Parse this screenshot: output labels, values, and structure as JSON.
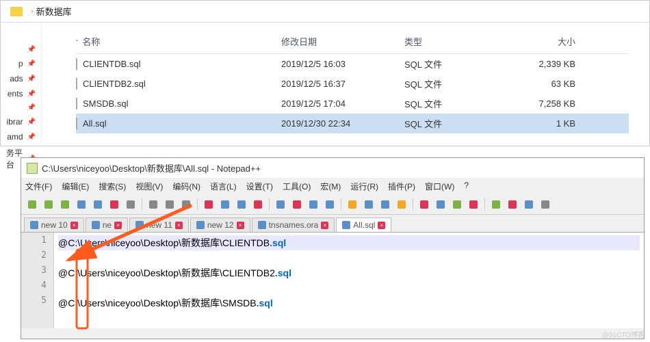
{
  "explorer": {
    "crumb": "新数据库",
    "headers": {
      "name": "名称",
      "date": "修改日期",
      "type": "类型",
      "size": "大小"
    },
    "rows": [
      {
        "name": "CLIENTDB.sql",
        "date": "2019/12/5 16:03",
        "type": "SQL 文件",
        "size": "2,339 KB",
        "sel": false
      },
      {
        "name": "CLIENTDB2.sql",
        "date": "2019/12/5 16:37",
        "type": "SQL 文件",
        "size": "63 KB",
        "sel": false
      },
      {
        "name": "SMSDB.sql",
        "date": "2019/12/5 17:04",
        "type": "SQL 文件",
        "size": "7,258 KB",
        "sel": false
      },
      {
        "name": "All.sql",
        "date": "2019/12/30 22:34",
        "type": "SQL 文件",
        "size": "1 KB",
        "sel": true
      }
    ],
    "sidebar": [
      "",
      "p",
      "ads",
      "ents",
      "",
      "ibrar",
      "amd",
      "务平台",
      ""
    ]
  },
  "notepad": {
    "title": "C:\\Users\\niceyoo\\Desktop\\新数据库\\All.sql - Notepad++",
    "menu": [
      "文件(F)",
      "编辑(E)",
      "搜索(S)",
      "视图(V)",
      "编码(N)",
      "语言(L)",
      "设置(T)",
      "工具(O)",
      "宏(M)",
      "运行(R)",
      "插件(P)",
      "窗口(W)",
      "?"
    ],
    "tabs": [
      {
        "label": "new 10",
        "active": false
      },
      {
        "label": "ne",
        "active": false
      },
      {
        "label": "new 11",
        "active": false
      },
      {
        "label": "new 12",
        "active": false
      },
      {
        "label": "tnsnames.ora",
        "active": false
      },
      {
        "label": "All.sql",
        "active": true
      }
    ],
    "lines": [
      {
        "n": "1",
        "pre": "@C:\\Users\\niceyoo\\Desktop\\新数据库\\CLIENTDB",
        "suf": ".sql",
        "hl": true
      },
      {
        "n": "2",
        "pre": "",
        "suf": "",
        "hl": false
      },
      {
        "n": "3",
        "pre": "@C:\\Users\\niceyoo\\Desktop\\新数据库\\CLIENTDB2",
        "suf": ".sql",
        "hl": false
      },
      {
        "n": "4",
        "pre": "",
        "suf": "",
        "hl": false
      },
      {
        "n": "5",
        "pre": "@C:\\Users\\niceyoo\\Desktop\\新数据库\\SMSDB",
        "suf": ".sql",
        "hl": false
      }
    ]
  },
  "watermark": "@51CTO博客"
}
